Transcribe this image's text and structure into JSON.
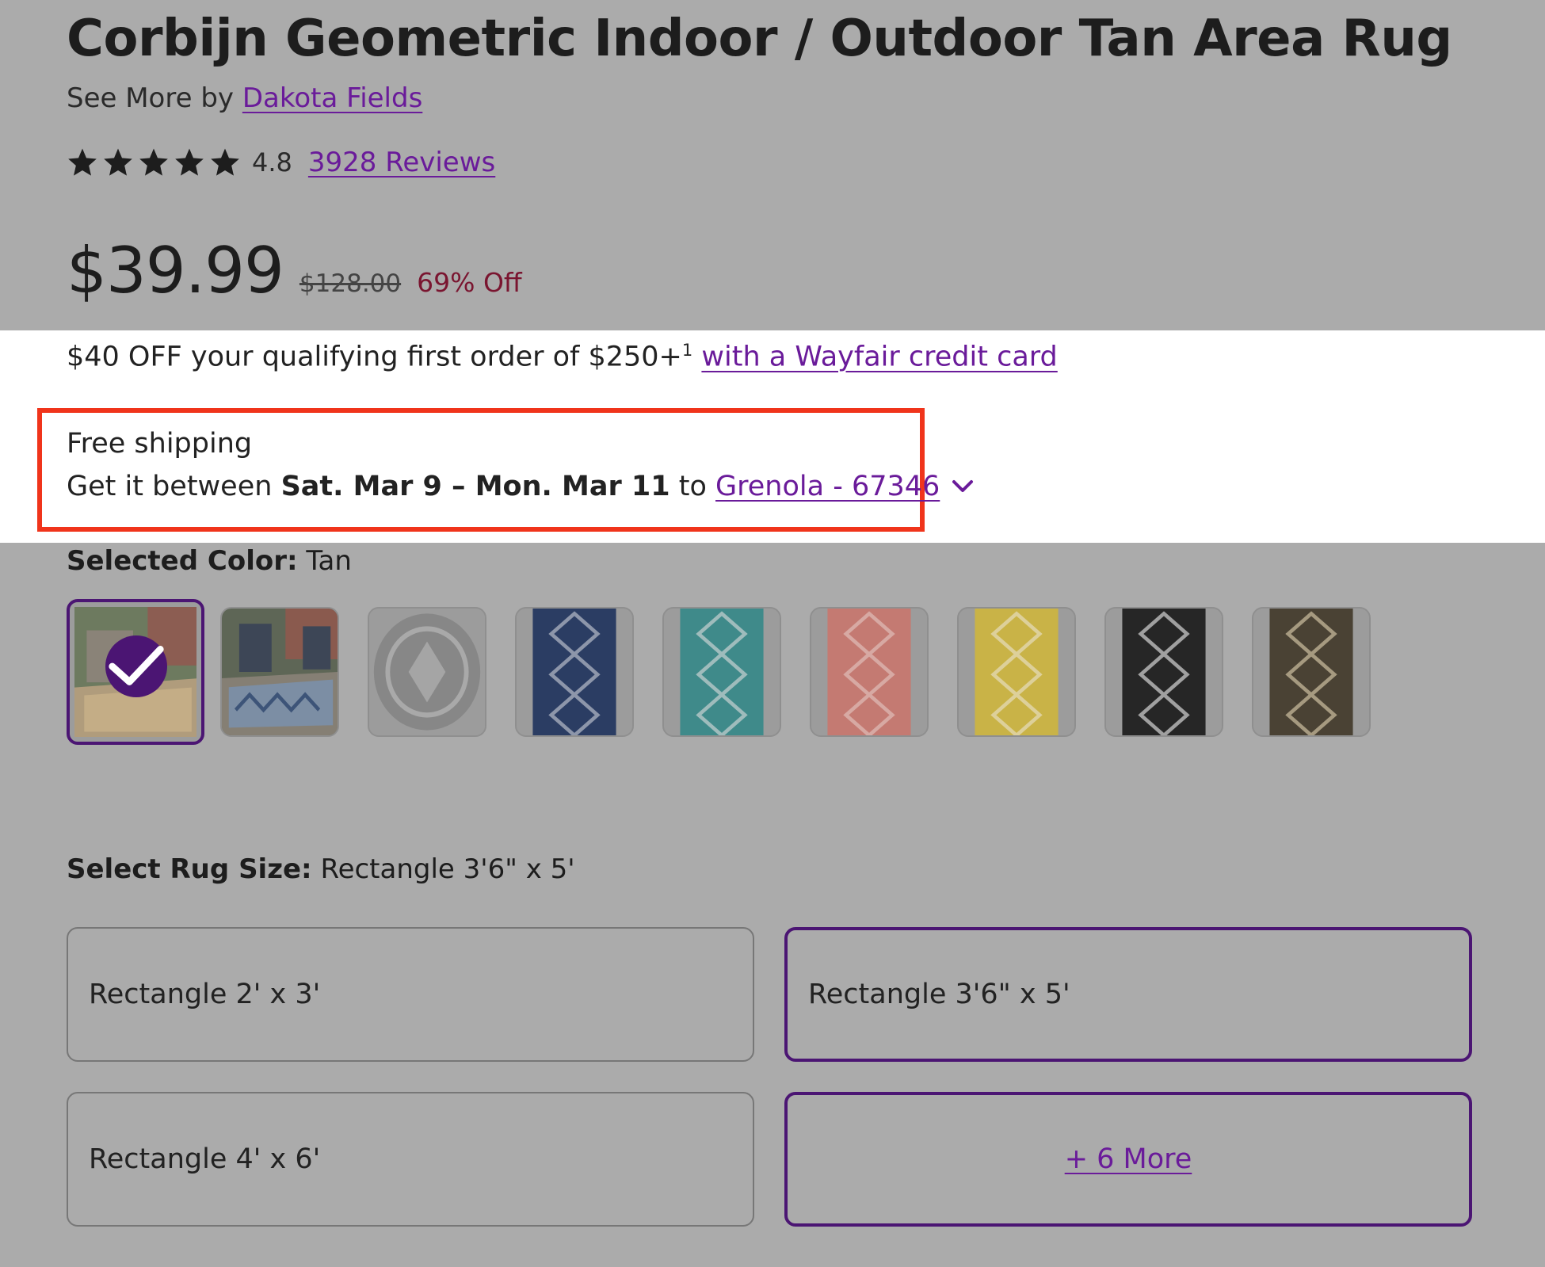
{
  "product": {
    "title": "Corbijn Geometric Indoor / Outdoor Tan Area Rug",
    "see_more_prefix": "See More by",
    "brand": "Dakota Fields",
    "rating": "4.8",
    "reviews": "3928 Reviews",
    "star_count": 5
  },
  "pricing": {
    "price": "$39.99",
    "original": "$128.00",
    "discount": "69% Off"
  },
  "promo": {
    "text": "$40 OFF your qualifying first order of $250+",
    "sup": "1",
    "link": "with a Wayfair credit card"
  },
  "shipping": {
    "label": "Free shipping",
    "prefix": "Get it between",
    "dates": "Sat. Mar 9 – Mon. Mar 11",
    "to": "to",
    "location": "Grenola - 67346"
  },
  "color": {
    "label": "Selected Color:",
    "value": "Tan",
    "swatches": [
      "tan",
      "blue-scene",
      "gray-round",
      "navy",
      "teal",
      "coral",
      "yellow",
      "black",
      "brown"
    ]
  },
  "size": {
    "label": "Select Rug Size:",
    "value": "Rectangle 3'6\" x 5'",
    "options": [
      "Rectangle 2' x 3'",
      "Rectangle 3'6\" x 5'",
      "Rectangle 4' x 6'"
    ],
    "more": "+ 6 More"
  },
  "colors": {
    "accent": "#6a1b9a",
    "selected_border": "#4b1573",
    "discount": "#7a1530",
    "highlight_box": "#f0341b"
  }
}
